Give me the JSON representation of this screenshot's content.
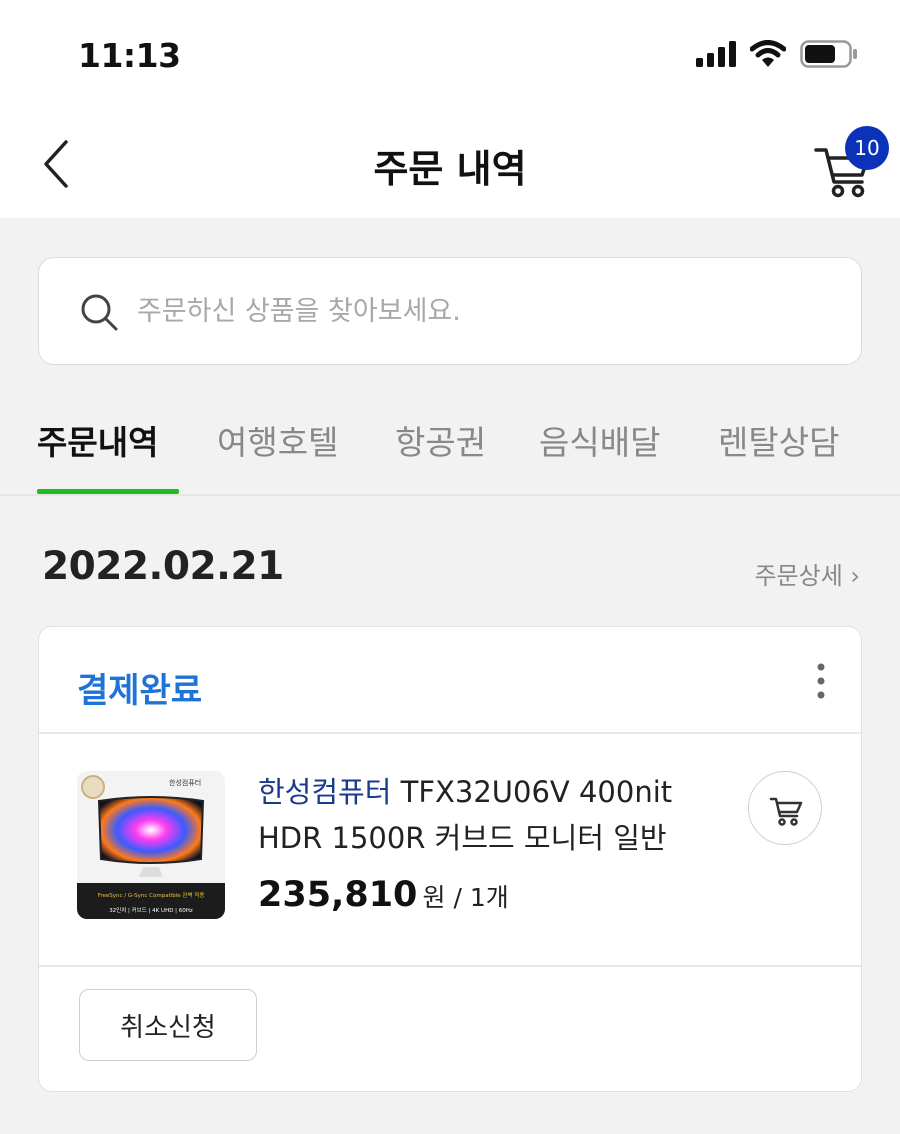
{
  "status_bar": {
    "time": "11:13"
  },
  "header": {
    "title": "주문 내역",
    "cart_count": "10"
  },
  "search": {
    "placeholder": "주문하신 상품을 찾아보세요."
  },
  "tabs": [
    {
      "label": "주문내역",
      "active": true
    },
    {
      "label": "여행호텔",
      "active": false
    },
    {
      "label": "항공권",
      "active": false
    },
    {
      "label": "음식배달",
      "active": false
    },
    {
      "label": "렌탈상담",
      "active": false
    }
  ],
  "order": {
    "date": "2022.02.21",
    "detail_link": "주문상세 ›",
    "status": "결제완료",
    "product": {
      "brand": "한성컴퓨터",
      "name": "TFX32U06V 400nit HDR 1500R 커브드 모니터 일반",
      "price": "235,810",
      "price_suffix": "원 / 1개",
      "thumb_brand": "한성컴퓨터",
      "thumb_banner": "FreeSync / G-Sync Compatible 완벽 적용",
      "thumb_specs": "32인치 | 커브드 | 4K UHD | 60Hz"
    },
    "cancel_label": "취소신청"
  },
  "colors": {
    "accent_tab": "#22bb22",
    "status_blue": "#1f73d6",
    "badge_blue": "#0b32b8",
    "brand_navy": "#1b3a8c"
  }
}
